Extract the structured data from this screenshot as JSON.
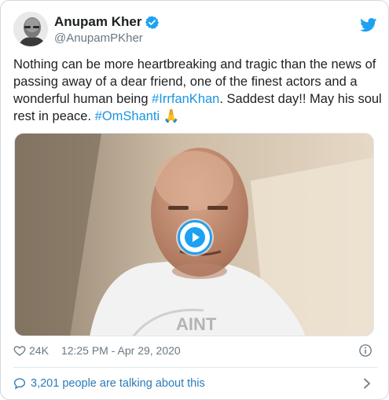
{
  "author": {
    "name": "Anupam Kher",
    "handle": "@AnupamPKher"
  },
  "tweet": {
    "line1": "Nothing can be more heartbreaking and tragic than the news of",
    "line2": "passing away of a dear friend, one of the finest actors and a",
    "line3_before": "wonderful human being ",
    "hashtag1": "#IrrfanKhan",
    "line3_after": ". Saddest day!! May his soul",
    "line4_before": "rest in peace. ",
    "hashtag2": "#OmShanti",
    "emoji": "🙏"
  },
  "meta": {
    "likes": "24K",
    "timestamp": "12:25 PM - Apr 29, 2020"
  },
  "footer": {
    "talking": "3,201 people are talking about this"
  },
  "icons": {
    "verified": "verified-badge-icon",
    "brand": "twitter-bird-icon",
    "like": "heart-icon",
    "info": "info-icon",
    "reply": "speech-bubble-icon",
    "more": "chevron-right-icon",
    "play": "play-icon"
  },
  "colors": {
    "accent": "#1da1f2",
    "link": "#1b95e0",
    "muted": "#697882"
  }
}
